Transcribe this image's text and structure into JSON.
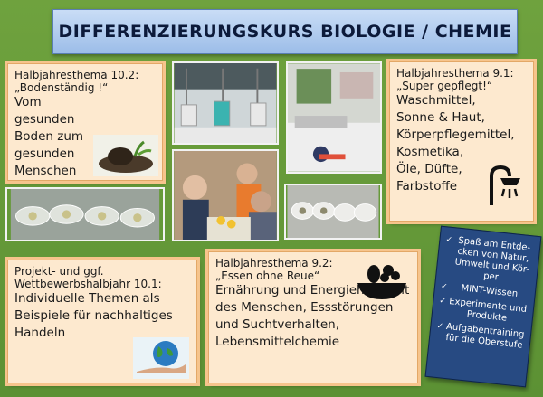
{
  "header": {
    "title": "DIFFERENZIERUNGSKURS  BIOLOGIE / CHEMIE"
  },
  "box_10_2": {
    "label": "Halbjahresthema  10.2:",
    "subtitle": "„Bodenständig !“",
    "body": "Vom gesunden Boden zum gesunden Menschen"
  },
  "box_9_1": {
    "label": "Halbjahresthema  9.1:",
    "subtitle": "„Super gepflegt!“",
    "items": [
      "Waschmittel,",
      "Sonne & Haut,",
      "Körperpflegemittel,",
      "Kosmetika,",
      "Öle, Düfte,",
      "Farbstoffe"
    ]
  },
  "box_10_1": {
    "label": "Projekt- und ggf.",
    "label2": "Wettbewerbshalbjahr  10.1:",
    "body": "Individuelle Themen als Beispiele für nachhaltiges Handeln"
  },
  "box_9_2": {
    "label": "Halbjahresthema 9.2:",
    "subtitle": "„Essen ohne Reue“",
    "body": "Ernährung und Energiehaushalt des Menschen, Essstörungen und Suchtverhalten, Lebensmittelchemie"
  },
  "bullets": [
    "Spaß am Entde-cken von Natur, Umwelt und Kör-per",
    "MINT-Wissen",
    "Experimente und Produkte",
    "Aufgabentraining für die Oberstufe"
  ],
  "icons": [
    "shower-icon",
    "fruit-bowl-icon"
  ],
  "colors": {
    "background": "#6fa23e",
    "box_fill": "#fde9cf",
    "title_bar": "#b3cdef",
    "blue_box": "#274a82"
  }
}
